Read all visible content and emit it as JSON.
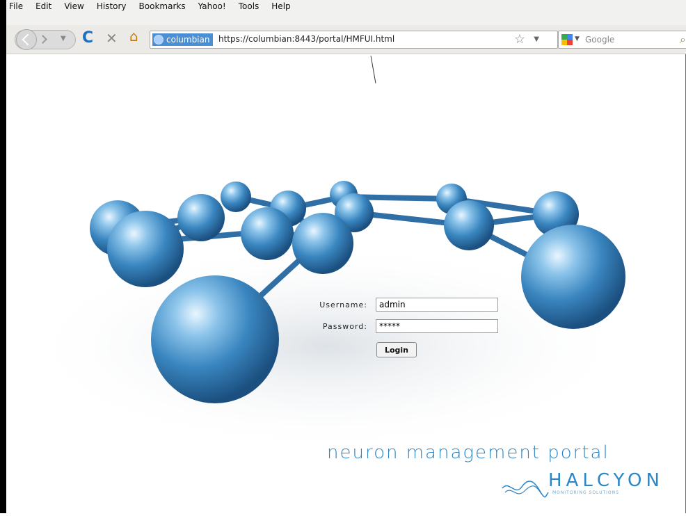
{
  "browser": {
    "menu": [
      "File",
      "Edit",
      "View",
      "History",
      "Bookmarks",
      "Yahoo!",
      "Tools",
      "Help"
    ],
    "identity_label": "columbian",
    "url": "https://columbian:8443/portal/HMFUI.html",
    "search_placeholder": "Google"
  },
  "login": {
    "username_label": "Username:",
    "username_value": "admin",
    "password_label": "Password:",
    "password_value": "*****",
    "login_button": "Login"
  },
  "branding": {
    "portal_title": "neuron management portal",
    "company": "HALCYON",
    "tagline": "MONITORING SOLUTIONS"
  },
  "colors": {
    "accent": "#2d86c5",
    "sphere": "#3a86c0"
  }
}
